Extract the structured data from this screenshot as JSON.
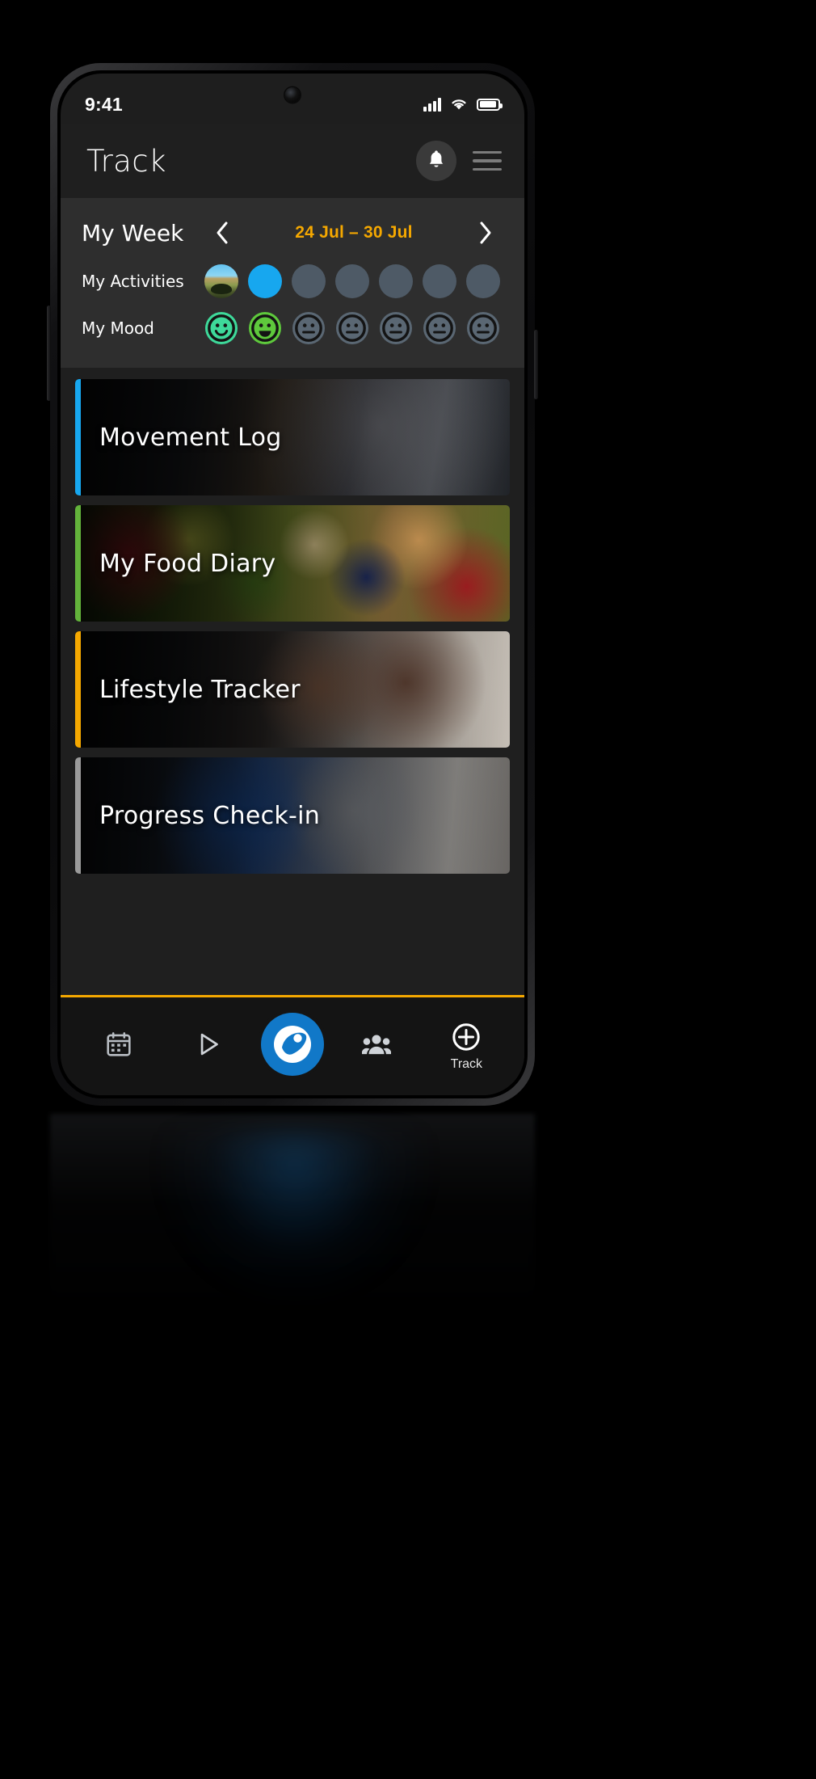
{
  "status_bar": {
    "time": "9:41",
    "signal_icon": "cellular-signal-icon",
    "wifi_icon": "wifi-icon",
    "battery_icon": "battery-icon",
    "battery_level_percent": 92
  },
  "header": {
    "title": "Track",
    "bell_icon": "notification-bell-icon",
    "menu_icon": "hamburger-menu-icon"
  },
  "week_card": {
    "label": "My Week",
    "prev_icon": "chevron-left-icon",
    "next_icon": "chevron-right-icon",
    "date_range": "24 Jul – 30 Jul",
    "accent_color": "#f5a800",
    "activities": {
      "label": "My Activities",
      "days": [
        {
          "state": "photo",
          "color": "#8fb04a"
        },
        {
          "state": "filled",
          "color": "#17a7ef"
        },
        {
          "state": "empty",
          "color": "#4e5a66"
        },
        {
          "state": "empty",
          "color": "#4e5a66"
        },
        {
          "state": "empty",
          "color": "#4e5a66"
        },
        {
          "state": "empty",
          "color": "#4e5a66"
        },
        {
          "state": "empty",
          "color": "#4e5a66"
        }
      ]
    },
    "mood": {
      "label": "My Mood",
      "days": [
        {
          "face": "smile",
          "color": "#3ed99a"
        },
        {
          "face": "grin",
          "color": "#5ec93c"
        },
        {
          "face": "neutral",
          "color": "#5a6773"
        },
        {
          "face": "neutral",
          "color": "#5a6773"
        },
        {
          "face": "neutral",
          "color": "#5a6773"
        },
        {
          "face": "neutral",
          "color": "#5a6773"
        },
        {
          "face": "neutral",
          "color": "#5a6773"
        }
      ]
    }
  },
  "cards": [
    {
      "title": "Movement Log",
      "accent": "#17a7ef",
      "image": "gym-leg-press-photo"
    },
    {
      "title": "My Food Diary",
      "accent": "#63b33b",
      "image": "healthy-food-bowls-photo"
    },
    {
      "title": "Lifestyle Tracker",
      "accent": "#f5a800",
      "image": "two-women-with-phone-gym-photo"
    },
    {
      "title": "Progress Check-in",
      "accent": "#9a9a9a",
      "image": "trainer-with-clipboard-photo"
    }
  ],
  "bottom_nav": {
    "accent_color": "#f5a800",
    "items": [
      {
        "label": "",
        "icon": "calendar-icon"
      },
      {
        "label": "",
        "icon": "play-icon"
      },
      {
        "label": "",
        "icon": "app-logo-icon"
      },
      {
        "label": "",
        "icon": "people-group-icon"
      },
      {
        "label": "Track",
        "icon": "plus-circle-icon"
      }
    ]
  }
}
